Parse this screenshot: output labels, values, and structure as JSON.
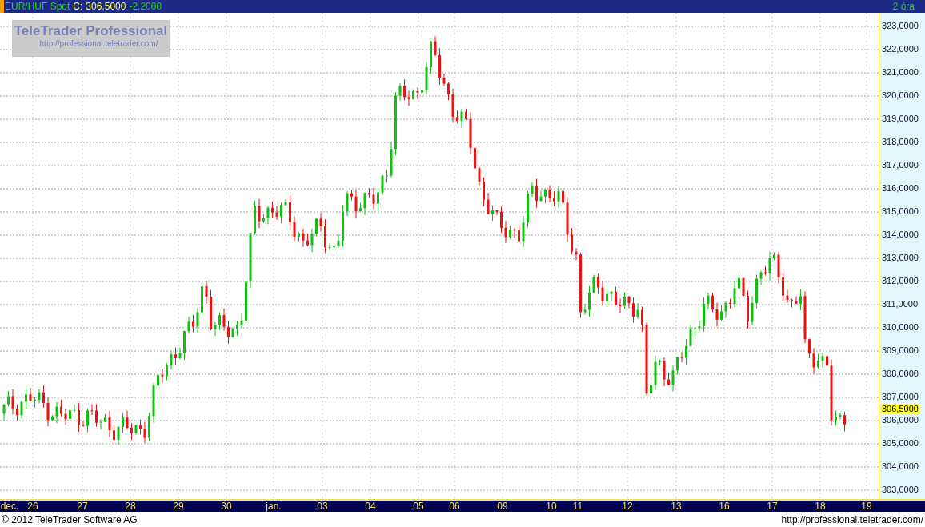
{
  "header": {
    "symbol": "EUR/HUF Spot",
    "close_label": "C:",
    "close": "306,5000",
    "change": "-2,2000",
    "interval": "2 óra"
  },
  "logo": {
    "title": "TeleTrader Professional",
    "url": "http://professional.teletrader.com/"
  },
  "price_axis": {
    "labels": [
      "323,0000",
      "322,0000",
      "321,0000",
      "320,0000",
      "319,0000",
      "318,0000",
      "317,0000",
      "316,0000",
      "315,0000",
      "314,0000",
      "313,0000",
      "312,0000",
      "311,0000",
      "310,0000",
      "309,0000",
      "308,0000",
      "307,0000",
      "306,0000",
      "305,0000",
      "304,0000",
      "303,0000"
    ],
    "current": "306,5000"
  },
  "date_axis": {
    "labels": [
      "dec.",
      "26",
      "27",
      "28",
      "29",
      "30",
      "jan.",
      "03",
      "04",
      "05",
      "06",
      "09",
      "10",
      "11",
      "12",
      "13",
      "16",
      "17",
      "18",
      "19"
    ]
  },
  "footer": {
    "copyright": "© 2012 TeleTrader Software AG",
    "url": "http://professional.teletrader.com/"
  }
}
